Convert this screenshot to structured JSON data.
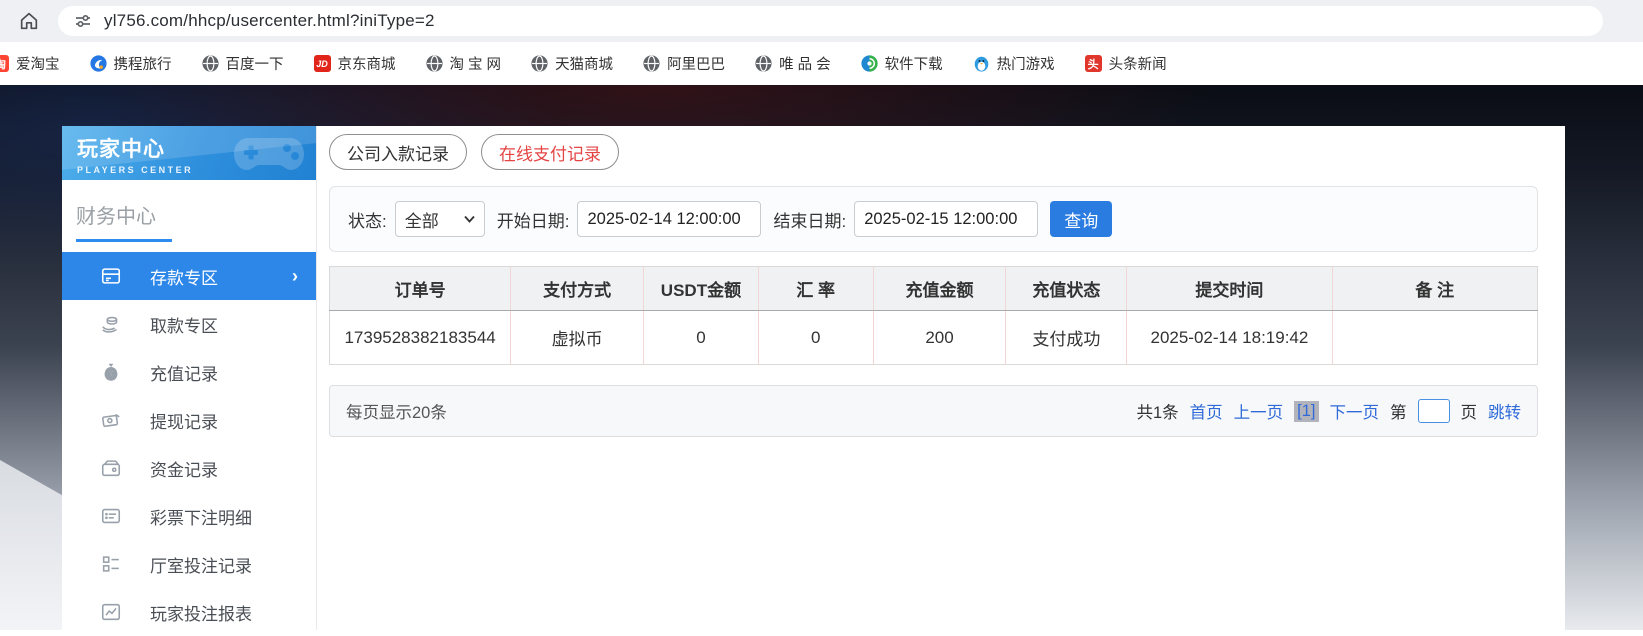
{
  "browser": {
    "url": "yl756.com/hhcp/usercenter.html?iniType=2",
    "favicon_glyphs": {
      "aitaobao": "淘",
      "jd": "JD",
      "toutiao": "头"
    },
    "bookmarks": [
      {
        "label": "爱淘宝"
      },
      {
        "label": "携程旅行"
      },
      {
        "label": "百度一下"
      },
      {
        "label": "京东商城"
      },
      {
        "label": "淘 宝 网"
      },
      {
        "label": "天猫商城"
      },
      {
        "label": "阿里巴巴"
      },
      {
        "label": "唯 品 会"
      },
      {
        "label": "软件下载"
      },
      {
        "label": "热门游戏"
      },
      {
        "label": "头条新闻"
      }
    ]
  },
  "sidebar": {
    "title": "玩家中心",
    "subtitle": "PLAYERS CENTER",
    "section": "财务中心",
    "items": [
      {
        "label": "存款专区",
        "active": true
      },
      {
        "label": "取款专区"
      },
      {
        "label": "充值记录"
      },
      {
        "label": "提现记录"
      },
      {
        "label": "资金记录"
      },
      {
        "label": "彩票下注明细"
      },
      {
        "label": "厅室投注记录"
      },
      {
        "label": "玩家投注报表"
      }
    ]
  },
  "tabs": [
    {
      "label": "公司入款记录",
      "active": false
    },
    {
      "label": "在线支付记录",
      "active": true
    }
  ],
  "filters": {
    "status_label": "状态:",
    "status_value": "全部",
    "start_label": "开始日期:",
    "start_value": "2025-02-14 12:00:00",
    "end_label": "结束日期:",
    "end_value": "2025-02-15 12:00:00",
    "search_button": "查询"
  },
  "table": {
    "headers": [
      "订单号",
      "支付方式",
      "USDT金额",
      "汇 率",
      "充值金额",
      "充值状态",
      "提交时间",
      "备 注"
    ],
    "rows": [
      [
        "1739528382183544",
        "虚拟币",
        "0",
        "0",
        "200",
        "支付成功",
        "2025-02-14 18:19:42",
        ""
      ]
    ]
  },
  "pagination": {
    "page_size_text": "每页显示20条",
    "total_text": "共1条",
    "first": "首页",
    "prev": "上一页",
    "current": "[1]",
    "next": "下一页",
    "jump_pre": "第",
    "jump_post": "页",
    "jump_button": "跳转"
  },
  "colors": {
    "accent_blue": "#2d87e8",
    "button_blue": "#2b7ce0",
    "link_blue": "#2f6bd8",
    "active_tab_red": "#e54444",
    "table_divider_pink": "#f0d6d6",
    "banner_blue": "#2e8fdd"
  }
}
